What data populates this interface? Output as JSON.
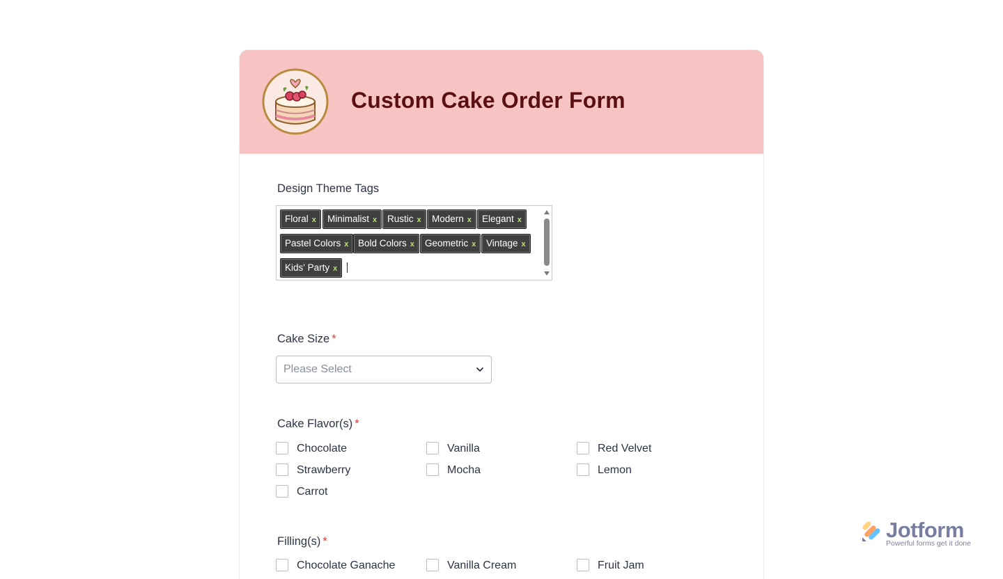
{
  "form": {
    "title": "Custom Cake Order Form",
    "logo_icon": "cake-icon",
    "header_color": "#f8c3c3",
    "title_color": "#5a0f12"
  },
  "design_tags": {
    "label": "Design Theme Tags",
    "tags": [
      "Floral",
      "Minimalist",
      "Rustic",
      "Modern",
      "Elegant",
      "Pastel Colors",
      "Bold Colors",
      "Geometric",
      "Vintage",
      "Kids' Party"
    ],
    "remove_glyph": "x"
  },
  "cake_size": {
    "label": "Cake Size",
    "required_mark": "*",
    "placeholder": "Please Select"
  },
  "cake_flavors": {
    "label": "Cake Flavor(s)",
    "required_mark": "*",
    "options": [
      "Chocolate",
      "Vanilla",
      "Red Velvet",
      "Strawberry",
      "Mocha",
      "Lemon",
      "Carrot"
    ]
  },
  "fillings": {
    "label": "Filling(s)",
    "required_mark": "*",
    "options": [
      "Chocolate Ganache",
      "Vanilla Cream",
      "Fruit Jam"
    ]
  },
  "badge": {
    "brand": "Jotform",
    "tagline": "Powerful forms get it done"
  }
}
